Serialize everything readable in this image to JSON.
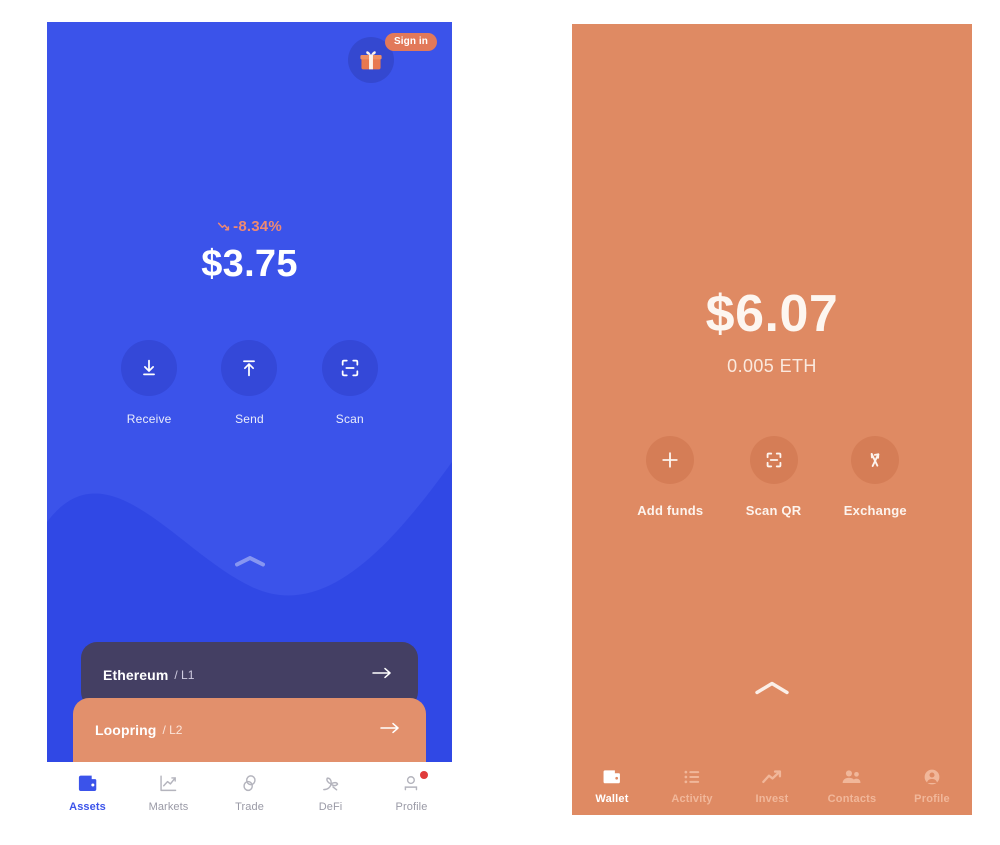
{
  "meta": {
    "colors": {
      "blue": "#3B53EA",
      "blue_dark": "#3448D0",
      "salmon": "#DF8A63",
      "salmon_dark": "#D57D56",
      "card_purple": "#443F63",
      "card_salmon": "#E2906C",
      "accent_coral": "#EF8A72",
      "badge_red": "#E03B3B",
      "white": "#FFFFFF"
    }
  },
  "phone_left": {
    "top_bar": {
      "gift_icon": "gift-icon",
      "signin_label": "Sign in"
    },
    "balance": {
      "change_percent": "-8.34%",
      "change_direction": "down",
      "trend_icon": "trend-down-icon",
      "amount": "$3.75"
    },
    "actions": [
      {
        "label": "Receive",
        "icon": "download-arrow-icon"
      },
      {
        "label": "Send",
        "icon": "upload-arrow-icon"
      },
      {
        "label": "Scan",
        "icon": "scan-frame-icon"
      }
    ],
    "drawer_handle_icon": "chevron-up-icon",
    "network_cards": [
      {
        "name": "Ethereum",
        "layer": "/ L1",
        "arrow_icon": "arrow-right-icon"
      },
      {
        "name": "Loopring",
        "layer": "/ L2",
        "arrow_icon": "arrow-right-icon"
      }
    ],
    "nav": [
      {
        "label": "Assets",
        "icon": "wallet-icon",
        "active": true,
        "badge": false
      },
      {
        "label": "Markets",
        "icon": "chart-line-icon",
        "active": false,
        "badge": false
      },
      {
        "label": "Trade",
        "icon": "rings-icon",
        "active": false,
        "badge": false
      },
      {
        "label": "DeFi",
        "icon": "leaf-icon",
        "active": false,
        "badge": false
      },
      {
        "label": "Profile",
        "icon": "person-icon",
        "active": false,
        "badge": true
      }
    ]
  },
  "phone_right": {
    "balance": {
      "amount": "$6.07",
      "crypto_amount": "0.005 ETH"
    },
    "actions": [
      {
        "label": "Add funds",
        "icon": "plus-icon"
      },
      {
        "label": "Scan QR",
        "icon": "scan-frame-icon"
      },
      {
        "label": "Exchange",
        "icon": "exchange-arrows-icon"
      }
    ],
    "drawer_handle_icon": "chevron-up-icon",
    "nav": [
      {
        "label": "Wallet",
        "icon": "wallet-icon",
        "active": true
      },
      {
        "label": "Activity",
        "icon": "list-icon",
        "active": false
      },
      {
        "label": "Invest",
        "icon": "trend-up-icon",
        "active": false
      },
      {
        "label": "Contacts",
        "icon": "people-icon",
        "active": false
      },
      {
        "label": "Profile",
        "icon": "avatar-icon",
        "active": false
      }
    ]
  }
}
